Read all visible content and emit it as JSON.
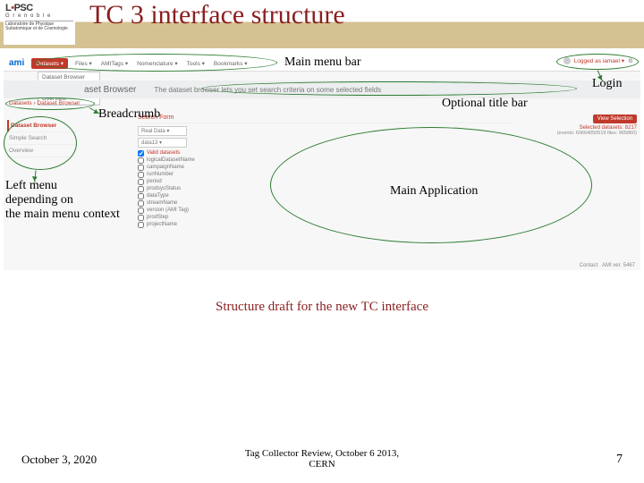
{
  "slide": {
    "title": "TC 3 interface structure",
    "logo_name": "LPSC",
    "logo_sub": "G r e n o b l e",
    "logo_lab": "Laboratoire de Physique Subatomique et de Cosmologie",
    "caption": "Structure draft for the new TC interface",
    "footer_date": "October 3, 2020",
    "footer_center_l1": "Tag Collector Review, October 6 2013,",
    "footer_center_l2": "CERN",
    "page_number": "7"
  },
  "annot": {
    "mainmenu": "Main menu bar",
    "login": "Login",
    "titlebar": "Optional title bar",
    "breadcrumb": "Breadcrumb",
    "leftmenu_l1": "Left menu",
    "leftmenu_l2": "depending on",
    "leftmenu_l3": "the main menu context",
    "mainapp": "Main Application"
  },
  "ui": {
    "logo": "ami",
    "menu": {
      "datasets": "Datasets ▾",
      "files": "Files ▾",
      "amitags": "AMITags ▾",
      "nomenclature": "Nomenclature ▾",
      "tools": "Tools ▾",
      "bookmarks": "Bookmarks ▾"
    },
    "dropdown": [
      "Dataset Browser",
      "Simple Search",
      "Overview"
    ],
    "login_text": "Logged as iamael ▾",
    "titlebar_h": "aset Browser",
    "titlebar_sub": "The dataset browser lets you set search criteria on some selected fields",
    "breadcrumb": "Datasets › Dataset Browser",
    "leftmenu": [
      "Dataset Browser",
      "Simple Search",
      "Overview"
    ],
    "main_header": "Search Form",
    "sel1": "Real Data ▾",
    "sel2": "data13 ▾",
    "checklist_first": "Valid datasets",
    "checklist": [
      "logicalDatasetName",
      "campaignName",
      "runNumber",
      "period",
      "prodsysStatus",
      "dataType",
      "streamName",
      "version (AMI Tag)",
      "prodStep",
      "projectName"
    ],
    "btn_view": "View Selection",
    "sel_count": "Selected datasets: 8217",
    "sel_detail": "(events: 60664050519    files: 965860)",
    "footer_contact": "Contact",
    "footer_ver": "AMI ver. 5467"
  }
}
